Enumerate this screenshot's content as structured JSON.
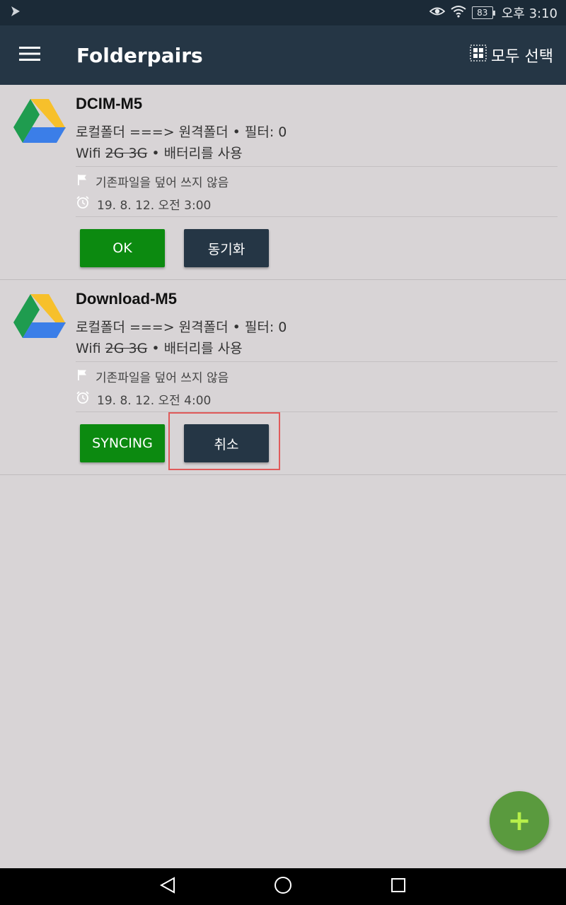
{
  "status_bar": {
    "battery": "83",
    "time": "오후 3:10"
  },
  "app_bar": {
    "title": "Folderpairs",
    "select_all_label": "모두 선택"
  },
  "folders": [
    {
      "name": "DCIM-M5",
      "direction": "로컬폴더 ===> 원격폴더 • 필터: 0",
      "network_prefix": "Wifi",
      "network_disabled": "2G 3G",
      "network_suffix": "• 배터리를 사용",
      "overwrite_text": "기존파일을 덮어 쓰지 않음",
      "schedule_text": "19. 8. 12. 오전 3:00",
      "status_button": "OK",
      "action_button": "동기화"
    },
    {
      "name": "Download-M5",
      "direction": "로컬폴더 ===> 원격폴더 • 필터: 0",
      "network_prefix": "Wifi",
      "network_disabled": "2G 3G",
      "network_suffix": "• 배터리를 사용",
      "overwrite_text": "기존파일을 덮어 쓰지 않음",
      "schedule_text": "19. 8. 12. 오전 4:00",
      "status_button": "SYNCING",
      "action_button": "취소"
    }
  ],
  "fab": {
    "label": "+"
  },
  "colors": {
    "app_bar": "#253645",
    "status_bar": "#1b2a37",
    "background": "#d8d4d6",
    "green_button": "#0c8a10",
    "dark_button": "#253645",
    "fab": "#5a9a3e",
    "highlight": "#e05a5a"
  },
  "icons": {
    "status_left": "app-notification-icon",
    "eye": "eye-comfort-icon",
    "wifi": "wifi-icon",
    "menu": "hamburger-menu-icon",
    "select_all": "grid-select-icon",
    "drive": "google-drive-icon",
    "flag": "flag-icon",
    "alarm": "alarm-clock-icon",
    "back": "back-triangle-icon",
    "home": "home-circle-icon",
    "recents": "recents-square-icon"
  }
}
